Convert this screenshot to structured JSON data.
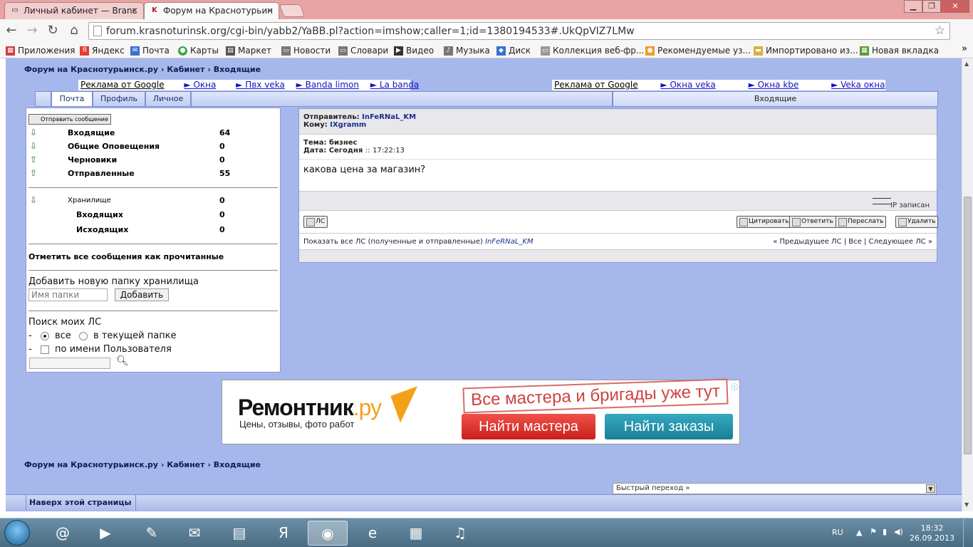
{
  "browser": {
    "tabs": [
      {
        "title": "Личный кабинет — Branc",
        "favicon": "page-icon"
      },
      {
        "title": "Форум на Краснотурьин",
        "favicon": "K"
      }
    ],
    "address": "forum.krasnoturinsk.org/cgi-bin/yabb2/YaBB.pl?action=imshow;caller=1;id=1380194533#.UkQpVIZ7LMw",
    "bookmarks": [
      {
        "label": "Приложения",
        "color": "#d43c3c"
      },
      {
        "label": "Яндекс",
        "color": "#e83a2f"
      },
      {
        "label": "Почта",
        "color": "#3a6fd4"
      },
      {
        "label": "Карты",
        "color": "#3aa64a"
      },
      {
        "label": "Маркет",
        "color": "#555555"
      },
      {
        "label": "Новости",
        "color": "#777777"
      },
      {
        "label": "Словари",
        "color": "#777777"
      },
      {
        "label": "Видео",
        "color": "#333333"
      },
      {
        "label": "Музыка",
        "color": "#777777"
      },
      {
        "label": "Диск",
        "color": "#3a6fd4"
      },
      {
        "label": "Коллекция веб-фр...",
        "color": "#999999"
      },
      {
        "label": "Рекомендуемые уз...",
        "color": "#f09a20"
      },
      {
        "label": "Импортировано из...",
        "color": "#d8b040"
      },
      {
        "label": "Новая вкладка",
        "color": "#5a9a3a"
      }
    ],
    "bookmarks_more": "»"
  },
  "forum": {
    "breadcrumb": {
      "site": "Форум на Краснотурьинск.ру",
      "sep": "›",
      "section": "Кабинет",
      "page": "Входящие"
    },
    "ads_left": {
      "label": "Реклама от Google",
      "links": [
        "► Окна",
        "► Пвх veka",
        "► Banda limon",
        "► La banda"
      ]
    },
    "ads_right": {
      "label": "Реклама от Google",
      "links": [
        "► Окна veka",
        "► Окна kbe",
        "► Veka окна"
      ]
    },
    "tabs": [
      "Почта",
      "Профиль",
      "Личное"
    ],
    "inbox_header": "Входящие",
    "sidebar": {
      "send_button": "Отправить сообщение",
      "folders": [
        {
          "name": "Входящие",
          "count": "64"
        },
        {
          "name": "Общие Оповещения",
          "count": "0"
        },
        {
          "name": "Черновики",
          "count": "0"
        },
        {
          "name": "Отправленные",
          "count": "55"
        }
      ],
      "storage": {
        "name": "Хранилище",
        "count": "0"
      },
      "storage_sub": [
        {
          "name": "Входящих",
          "count": "0"
        },
        {
          "name": "Исходящих",
          "count": "0"
        }
      ],
      "mark_all_read": "Отметить все сообщения как прочитанные",
      "add_folder_title": "Добавить новую папку хранилища",
      "folder_placeholder": "Имя папки",
      "add_button": "Добавить",
      "search_title": "Поиск моих ЛС",
      "dash": "-",
      "opt_all": "все",
      "opt_current": "в текущей папке",
      "opt_user": "по имени Пользователя"
    },
    "message": {
      "from_label": "Отправитель:",
      "from": "InFeRNaL_KM",
      "to_label": "Кому:",
      "to": "IXgramm",
      "subject_label": "Тема:",
      "subject": "бизнес",
      "date_label": "Дата:",
      "date": "Сегодня",
      "time_sep": "::",
      "time": "17:22:13",
      "body": "какова цена за магазин?",
      "ip_text": "IP записан",
      "pm_button": "ЛС",
      "actions": [
        "Цитировать",
        "Ответить",
        "Переслать",
        "Удалить"
      ],
      "show_all_text": "Показать все ЛС (полученные и отправленные)",
      "show_all_user": "InFeRNaL_KM",
      "nav": "« Предыдущее ЛС | Все | Следующее ЛС »"
    },
    "banner": {
      "brand": "Ремонтник",
      "brand_suffix": ".ру",
      "sub": "Цены, отзывы, фото работ",
      "slogan": "Все мастера и бригады уже тут",
      "btn_master": "Найти мастера",
      "btn_orders": "Найти заказы",
      "info": "ⓘ"
    },
    "quick_jump": "Быстрый переход »",
    "back_to_top": "Наверх этой страницы"
  },
  "taskbar": {
    "lang": "RU",
    "time": "18:32",
    "date": "26.09.2013"
  }
}
